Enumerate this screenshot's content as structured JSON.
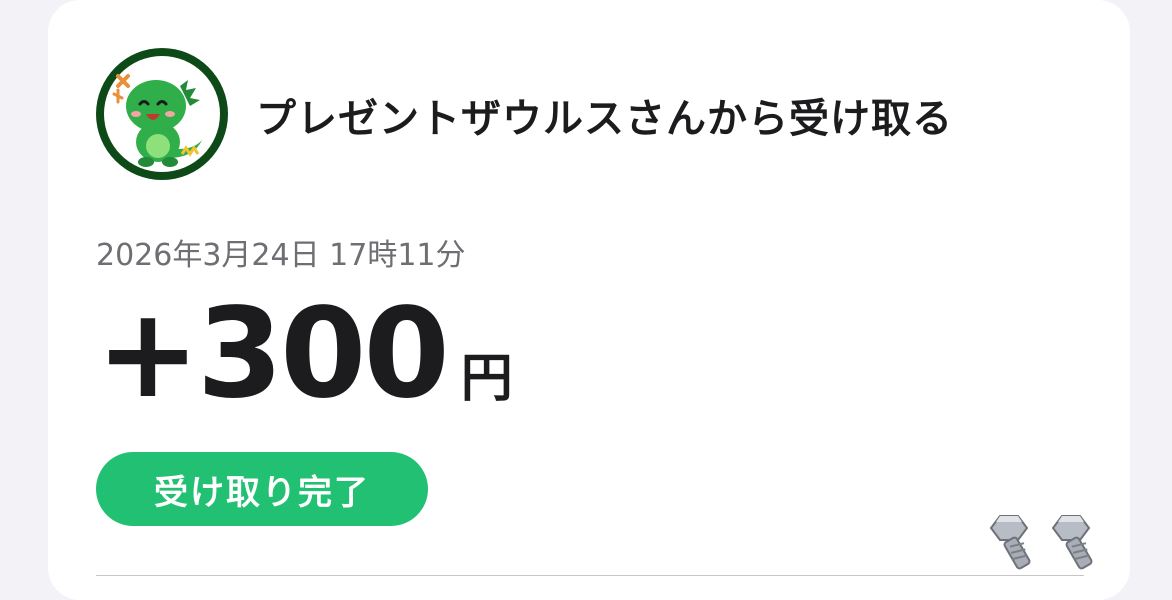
{
  "transaction": {
    "sender_line": "プレゼントザウルスさんから受け取る",
    "timestamp": "2026年3月24日 17時11分",
    "amount": "+300",
    "currency": "円",
    "status": "受け取り完了"
  },
  "avatar": {
    "icon": "green-dinosaur-avatar",
    "ring_color": "#0d4a18",
    "body_color": "#2fae4a"
  },
  "stamps": {
    "icon": "bolt-sticker-icon",
    "count": 2
  },
  "colors": {
    "status_green": "#22c073",
    "text_primary": "#1c1c1e",
    "text_secondary": "#6e6e73",
    "background": "#f2f2f7"
  }
}
